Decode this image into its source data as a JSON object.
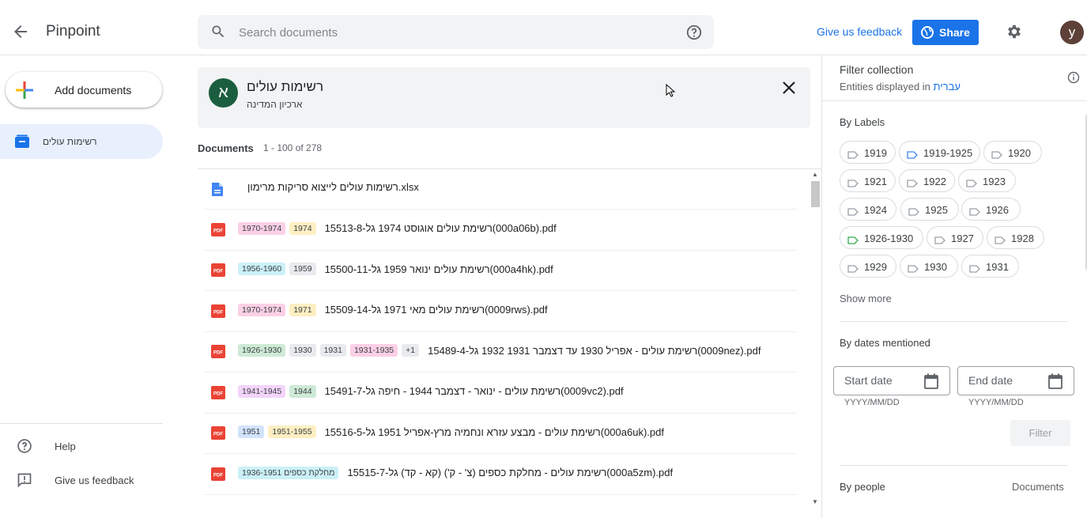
{
  "app": {
    "title": "Pinpoint"
  },
  "search": {
    "placeholder": "Search documents"
  },
  "header": {
    "feedback": "Give us feedback",
    "share": "Share",
    "avatar_letter": "y"
  },
  "sidebar": {
    "add_documents": "Add documents",
    "collection_item": "רשימות עולים",
    "help": "Help",
    "feedback": "Give us feedback"
  },
  "collection": {
    "badge_letter": "א",
    "title": "רשימות עולים",
    "subtitle": "ארכיון המדינה"
  },
  "documents": {
    "label": "Documents",
    "range": "1 - 100 of 278",
    "rows": [
      {
        "type": "xlsx",
        "chips": [],
        "name": "רשימות עולים לייצוא סריקות מרימון.xlsx"
      },
      {
        "type": "pdf",
        "chips": [
          {
            "text": "1970-1974",
            "color": "#fbd0e6"
          },
          {
            "text": "1974",
            "color": "#feefc3"
          }
        ],
        "name": "15513-8-רשימת עולים אוגוסט 1974 גל(000a06b).pdf"
      },
      {
        "type": "pdf",
        "chips": [
          {
            "text": "1956-1960",
            "color": "#cbf0f8"
          },
          {
            "text": "1959",
            "color": "#e8eaed"
          }
        ],
        "name": "15500-11-רשימת עולים ינואר 1959 גל(000a4hk).pdf"
      },
      {
        "type": "pdf",
        "chips": [
          {
            "text": "1970-1974",
            "color": "#fbd0e6"
          },
          {
            "text": "1971",
            "color": "#feefc3"
          }
        ],
        "name": "15509-14-רשימת עולים מאי 1971 גל(0009rws).pdf"
      },
      {
        "type": "pdf",
        "chips": [
          {
            "text": "1926-1930",
            "color": "#ceead6"
          },
          {
            "text": "1930",
            "color": "#e8eaed"
          },
          {
            "text": "1931",
            "color": "#e8eaed"
          },
          {
            "text": "1931-1935",
            "color": "#fbd0e6"
          },
          {
            "text": "+1",
            "color": "#e8eaed"
          }
        ],
        "name": "15489-4-רשימת עולים - אפריל 1930 עד דצמבר 1931 1932 גל(0009nez).pdf"
      },
      {
        "type": "pdf",
        "chips": [
          {
            "text": "1941-1945",
            "color": "#f3d4fb"
          },
          {
            "text": "1944",
            "color": "#ceead6"
          }
        ],
        "name": "15491-7-רשימת עולים - ינואר - דצמבר 1944 - חיפה גל(0009vc2).pdf"
      },
      {
        "type": "pdf",
        "chips": [
          {
            "text": "1951",
            "color": "#d2e3fc"
          },
          {
            "text": "1951-1955",
            "color": "#feefc3"
          }
        ],
        "name": "15516-5-רשימת עולים - מבצע עזרא ונחמיה מרץ-אפריל 1951 גל(000a6uk).pdf"
      },
      {
        "type": "pdf",
        "chips": [
          {
            "text": "1936-1951 מחלקת כספים",
            "color": "#cbf0f8"
          }
        ],
        "name": "15515-7-רשימת עולים - מחלקת כספים (צ' - ק') (קא - קד) גל(000a5zm).pdf"
      }
    ]
  },
  "filters": {
    "title": "Filter collection",
    "entities_prefix": "Entities displayed in",
    "entities_language": "עברית",
    "by_labels": "By Labels",
    "labels": [
      {
        "text": "1919",
        "color": "#9aa0a6"
      },
      {
        "text": "1919-1925",
        "color": "#4285f4"
      },
      {
        "text": "1920",
        "color": "#9aa0a6"
      },
      {
        "text": "1921",
        "color": "#9aa0a6"
      },
      {
        "text": "1922",
        "color": "#9aa0a6"
      },
      {
        "text": "1923",
        "color": "#9aa0a6"
      },
      {
        "text": "1924",
        "color": "#9aa0a6"
      },
      {
        "text": "1925",
        "color": "#9aa0a6"
      },
      {
        "text": "1926",
        "color": "#9aa0a6"
      },
      {
        "text": "1926-1930",
        "color": "#34a853"
      },
      {
        "text": "1927",
        "color": "#9aa0a6"
      },
      {
        "text": "1928",
        "color": "#9aa0a6"
      },
      {
        "text": "1929",
        "color": "#9aa0a6"
      },
      {
        "text": "1930",
        "color": "#9aa0a6"
      },
      {
        "text": "1931",
        "color": "#9aa0a6"
      }
    ],
    "show_more": "Show more",
    "by_dates": "By dates mentioned",
    "start_placeholder": "Start date",
    "end_placeholder": "End date",
    "date_format": "YYYY/MM/DD",
    "filter_button": "Filter",
    "by_people": "By people",
    "people_col": "Documents"
  }
}
